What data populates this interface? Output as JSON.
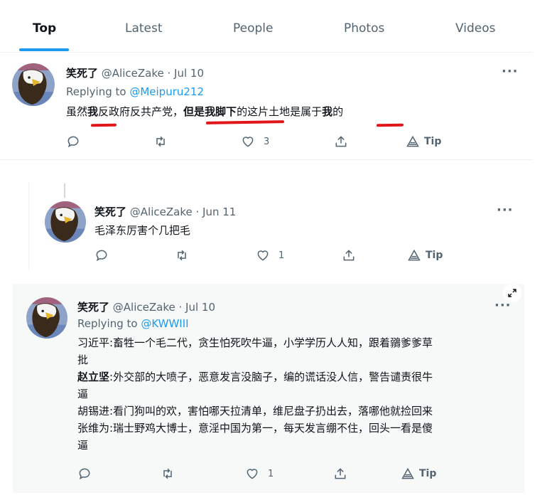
{
  "tabs": [
    {
      "label": "Top",
      "active": true
    },
    {
      "label": "Latest",
      "active": false
    },
    {
      "label": "People",
      "active": false
    },
    {
      "label": "Photos",
      "active": false
    },
    {
      "label": "Videos",
      "active": false
    }
  ],
  "tweets": [
    {
      "name": "笑死了",
      "handle": "@AliceZake",
      "date": "· Jul 10",
      "replying_prefix": "Replying to ",
      "replying_to": "@Meipuru212",
      "text_segments": [
        {
          "t": "虽然",
          "b": false
        },
        {
          "t": "我",
          "b": true
        },
        {
          "t": "反政府反共产党，",
          "b": false
        },
        {
          "t": "但是我脚下",
          "b": true
        },
        {
          "t": "的这片土地是属于",
          "b": false
        },
        {
          "t": "我",
          "b": true
        },
        {
          "t": "的",
          "b": false
        }
      ],
      "likes": "3",
      "retweets": "",
      "tip_label": "Tip",
      "more": "···"
    },
    {
      "name": "笑死了",
      "handle": "@AliceZake",
      "date": "· Jun 11",
      "text": "毛泽东厉害个几把毛",
      "likes": "1",
      "tip_label": "Tip",
      "more": "···"
    },
    {
      "name": "笑死了",
      "handle": "@AliceZake",
      "date": "· Jul 10",
      "replying_prefix": "Replying to ",
      "replying_to": "@KWWIII",
      "lines": [
        {
          "bold": "",
          "rest": "习近平:畜牲一个毛二代，贪生怕死吹牛逼，小学学历人人知，跟着鶸爹爹草"
        },
        {
          "bold": "",
          "rest": "批"
        },
        {
          "bold": "赵立坚",
          "rest": ":外交部的大喷子，恶意发言没脑子，编的谎话没人信，警告谴责很牛"
        },
        {
          "bold": "",
          "rest": "逼"
        },
        {
          "bold": "",
          "rest": "胡锡进:看门狗叫的欢，害怕哪天拉清单，维尼盘子扔出去，落哪他就捡回来"
        },
        {
          "bold": "",
          "rest": "张维为:瑞士野鸡大博士，意淫中国为第一，每天发言绷不住，回头一看是傻"
        },
        {
          "bold": "",
          "rest": "逼"
        }
      ],
      "likes": "1",
      "tip_label": "Tip",
      "more": "···"
    }
  ],
  "colors": {
    "accent": "#1d9bf0",
    "text": "#0f1419",
    "muted": "#536471",
    "highlight_bg": "#f7f9f9",
    "annotation": "#e0161b"
  },
  "icons": [
    "reply-icon",
    "retweet-icon",
    "like-icon",
    "share-icon",
    "tip-icon",
    "more-icon",
    "expand-icon",
    "avatar-eagle"
  ]
}
